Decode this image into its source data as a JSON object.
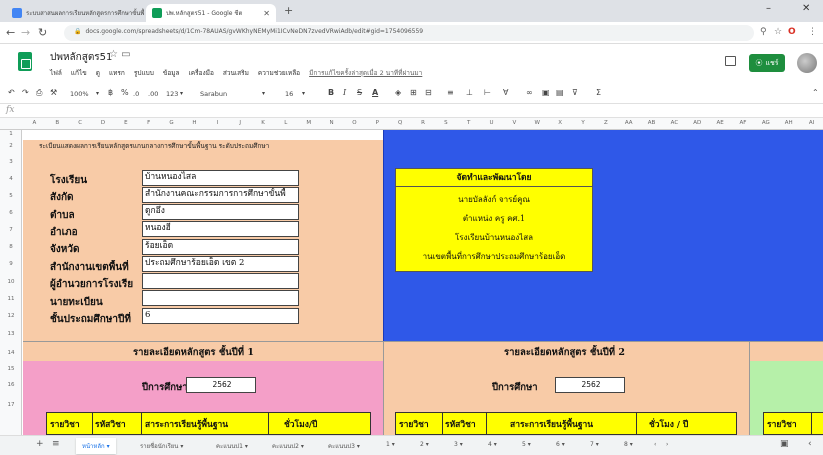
{
  "browser": {
    "tabs": [
      {
        "title": "ระบบสาสนผลการเรียนหลักสูตรการศึกษาขั้นพื้นฐาน",
        "active": false,
        "fav_color": "#4285f4"
      },
      {
        "title": "ปพ.หลักสูตร51 - Google ชีต",
        "active": true,
        "fav_color": "#0f9d58"
      }
    ],
    "new_tab": "+",
    "window_controls": [
      "–",
      "✕"
    ],
    "url": "docs.google.com/spreadsheets/d/1Cm-78AUAS/gvWKhyNEMyMi1ICvNeDN7zvedVRwiAdb/edit#gid=1754096559"
  },
  "doc": {
    "title": "ปพหลักสูตร51",
    "menus": [
      "ไฟล์",
      "แก้ไข",
      "ดู",
      "แทรก",
      "รูปแบบ",
      "ข้อมูล",
      "เครื่องมือ",
      "ส่วนเสริม",
      "ความช่วยเหลือ"
    ],
    "last_edit": "มีการแก้ไขครั้งล่าสุดเมื่อ 2 นาทีที่ผ่านมา",
    "share_label": "แชร์"
  },
  "toolbar": {
    "zoom": "100%",
    "currency": "฿",
    "percent": "%",
    "dec_less": ".0",
    "dec_more": ".00",
    "more_formats": "123",
    "font": "Sarabun",
    "font_size": "16"
  },
  "columns": [
    "A",
    "B",
    "C",
    "D",
    "E",
    "F",
    "G",
    "H",
    "I",
    "J",
    "K",
    "L",
    "M",
    "N",
    "O",
    "P",
    "Q",
    "R",
    "S",
    "T",
    "U",
    "V",
    "W",
    "X",
    "Y",
    "Z",
    "AA",
    "AB",
    "AC",
    "AD",
    "AE",
    "AF",
    "AG",
    "AH",
    "AI"
  ],
  "rows": [
    "1",
    "2",
    "3",
    "4",
    "5",
    "6",
    "7",
    "8",
    "9",
    "10",
    "11",
    "12",
    "13",
    "14",
    "15",
    "16",
    "17"
  ],
  "sheet": {
    "banner": "ระเบียนแสดงผลการเรียนหลักสูตรแกนกลางการศึกษาขั้นพื้นฐาน ระดับประถมศึกษา",
    "fields": [
      {
        "label": "โรงเรียน",
        "value": "บ้านหนองไสล"
      },
      {
        "label": "สังกัด",
        "value": "สำนักงานคณะกรรมการการศึกษาขั้นพื้"
      },
      {
        "label": "ตำบล",
        "value": "ดูกอึ่ง"
      },
      {
        "label": "อำเภอ",
        "value": "หนองฮี"
      },
      {
        "label": "จังหวัด",
        "value": "ร้อยเอ็ด"
      },
      {
        "label": "สำนักงานเขตพื้นที่",
        "value": "ประถมศึกษาร้อยเอ็ด เขต 2"
      },
      {
        "label": "ผู้อำนวยการโรงเรีย",
        "value": ""
      },
      {
        "label": "นายทะเบียน",
        "value": ""
      },
      {
        "label": "ชั้นประถมศึกษาปีที่",
        "value": "6"
      }
    ],
    "dev_box": {
      "title": "จัดทำและพัฒนาโดย",
      "lines": [
        "นายบัลลังก์ จารย์คูณ",
        "ตำแหน่ง ครู คศ.1",
        "โรงเรียนบ้านหนองไสล",
        "านเขตพื้นที่การศึกษาประถมศึกษาร้อยเอ็ด"
      ]
    },
    "grade1": {
      "heading": "รายละเอียดหลักสูตร ชั้นปีที่ 1",
      "year_label": "ปีการศึกษา",
      "year": "2562",
      "cols": [
        "รายวิชา",
        "รหัสวิชา",
        "สาระการเรียนรู้พื้นฐาน",
        "ชั่วโมง/ปี"
      ]
    },
    "grade2": {
      "heading": "รายละเอียดหลักสูตร ชั้นปีที่ 2",
      "year_label": "ปีการศึกษา",
      "year": "2562",
      "cols": [
        "รายวิชา",
        "รหัสวิชา",
        "สาระการเรียนรู้พื้นฐาน",
        "ชั่วโมง / ปี"
      ]
    },
    "grade3_partial": {
      "col": "รายวิชา"
    }
  },
  "sheet_tabs": [
    "หน้าหลัก",
    "รายชื่อนักเรียน",
    "คะแนนป1",
    "คะแนนป2",
    "คะแนนป3",
    "1",
    "2",
    "3",
    "4",
    "5",
    "6",
    "7",
    "8"
  ],
  "colors": {
    "orange": "#f8cba7",
    "blue": "#2f58e8",
    "yellow": "#ffff00",
    "pink": "#f49fc8",
    "green": "#b6f0a9",
    "share": "#1e8e3e"
  }
}
